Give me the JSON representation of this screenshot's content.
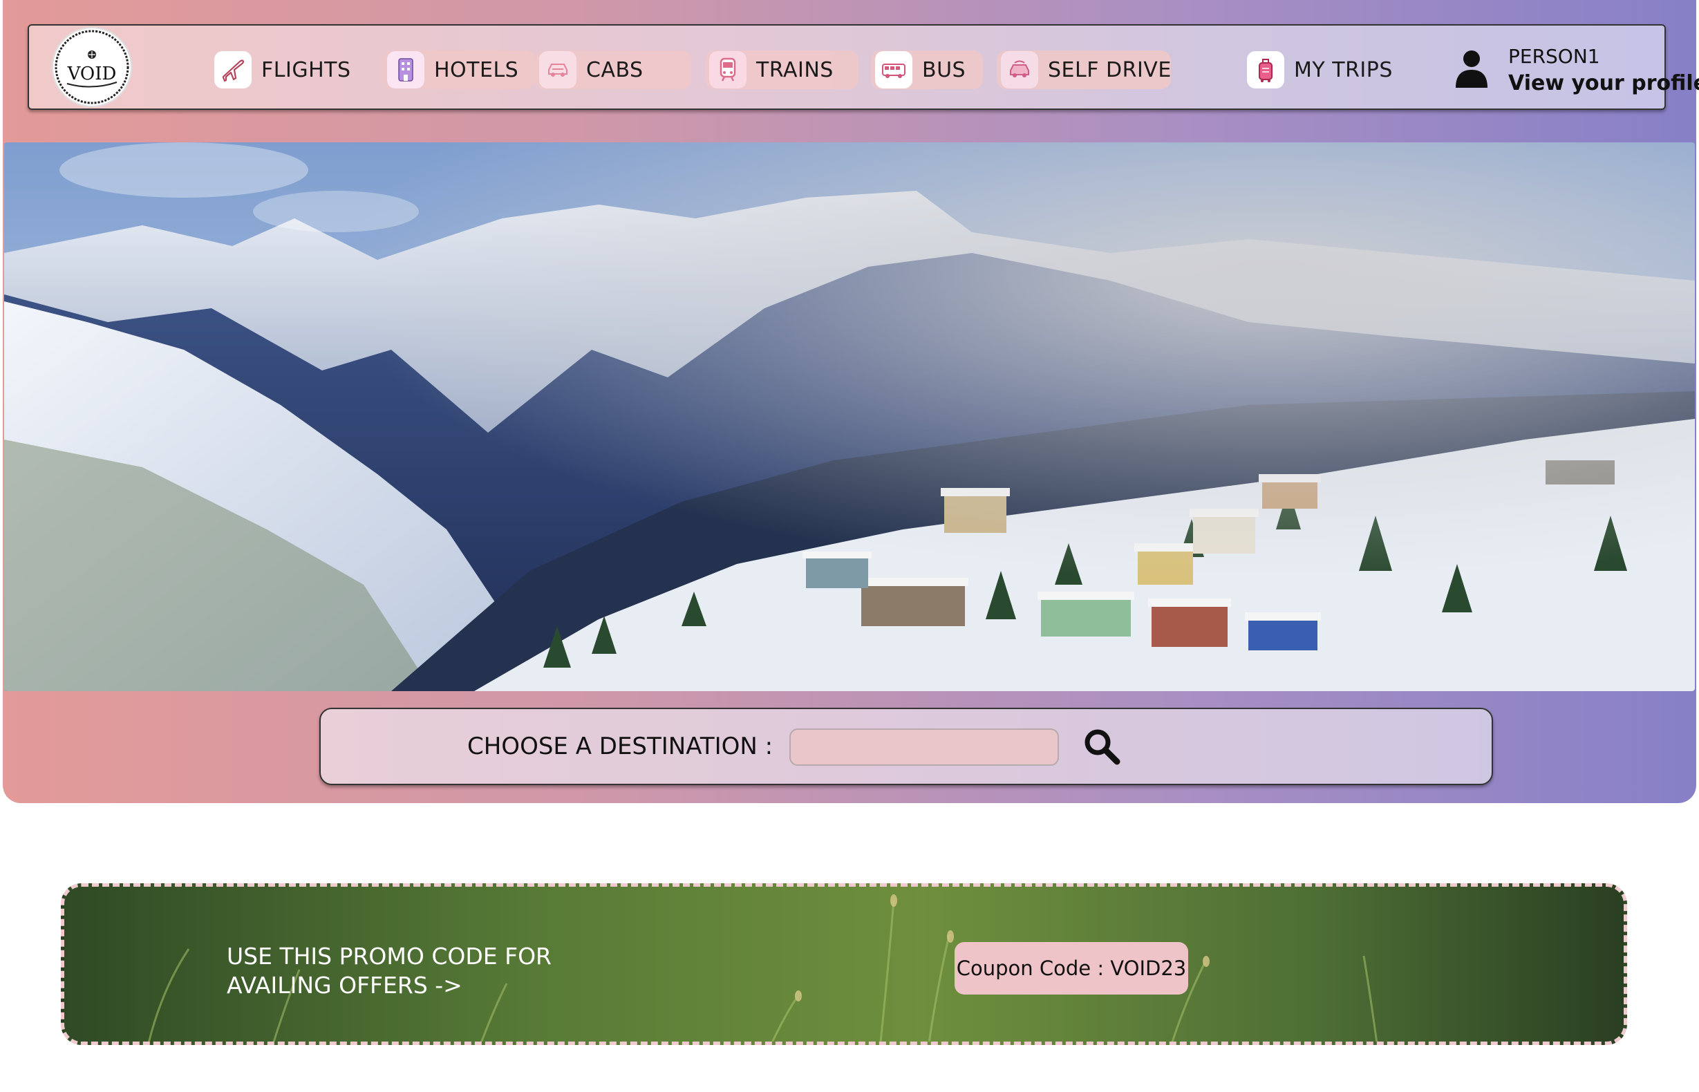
{
  "brand": {
    "logo_text": "VOID",
    "logo_icon": "globe-icon"
  },
  "nav": {
    "items": [
      {
        "label": "FLIGHTS",
        "icon": "airplane-icon"
      },
      {
        "label": "HOTELS",
        "icon": "hotel-icon"
      },
      {
        "label": "CABS",
        "icon": "car-icon"
      },
      {
        "label": "TRAINS",
        "icon": "train-icon"
      },
      {
        "label": "BUS",
        "icon": "bus-icon"
      },
      {
        "label": "SELF DRIVE",
        "icon": "self-drive-car-icon"
      },
      {
        "label": "MY TRIPS",
        "icon": "luggage-icon"
      }
    ]
  },
  "profile": {
    "name": "PERSON1",
    "link": "View your profile",
    "icon": "user-icon"
  },
  "hero": {
    "image": "snowy-mountain-village-photo"
  },
  "search": {
    "label": "CHOOSE A DESTINATION :",
    "value": "",
    "icon": "search-icon"
  },
  "promo": {
    "line1": "USE THIS PROMO CODE FOR",
    "line2": "AVAILING OFFERS ->",
    "coupon": "Coupon Code : VOID23"
  },
  "colors": {
    "gradient_start": "#e39a98",
    "gradient_end": "#8780c7",
    "nav_pill": "#f0c8c8",
    "coupon_bg": "#eec4c8",
    "promo_border": "#efcbcf"
  }
}
